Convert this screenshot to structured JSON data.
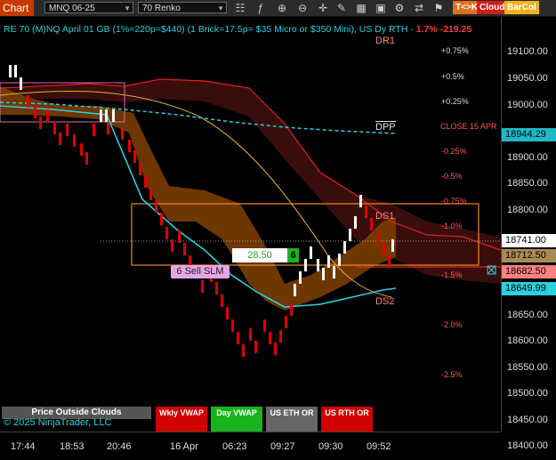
{
  "toolbar": {
    "tab_label": "Chart",
    "instrument": "MNQ 06-25",
    "bar_type": "70 Renko",
    "tkk_label": "T<>K",
    "cloud_label": "Cloud",
    "barcol_label": "BarCol"
  },
  "title": {
    "text": "RE 70 (M)NQ April 01 GB (1%=220p=$440) (1 Brick=17.5p= $35 Micro or $350 Mini), US Dy RTH  -",
    "change": "1.7%  -219.25"
  },
  "levels": {
    "dr1": "DR1",
    "dpp": "DPP",
    "ds1": "DS1",
    "ds2": "DS2",
    "close_label": "CLOSE 15 APR"
  },
  "pct_labels": [
    "+0.75%",
    "+0.5%",
    "+0.25%",
    "-0.25%",
    "-0.5%",
    "-0.75%",
    "-1.0%",
    "-1.5%",
    "-2.0%",
    "-2.5%"
  ],
  "y_ticks": [
    "19100.00",
    "19050.00",
    "19000.00",
    "18900.00",
    "18850.00",
    "18800.00",
    "18650.00",
    "18600.00",
    "18550.00",
    "18500.00",
    "18450.00",
    "18400.00"
  ],
  "price_labels": {
    "dpp": "18944.29",
    "last": "18741.00",
    "ds1": "18712.50",
    "ds2": "18682.50",
    "vwap": "18649.99"
  },
  "x_ticks": [
    "17:44",
    "18:53",
    "20:46",
    "16 Apr",
    "06:23",
    "09:27",
    "09:30",
    "09:52"
  ],
  "trade": {
    "ticks": "28.50",
    "count": "6",
    "order": "6 Sell SLM"
  },
  "panels": {
    "price_outside": "Price Outside Clouds",
    "wkly_vwap": "Wkly VWAP",
    "day_vwap": "Day VWAP",
    "us_eth": "US ETH OR",
    "us_rth": "US RTH OR"
  },
  "copyright": "© 2025 NinjaTrader, LLC",
  "colors": {
    "accent": "#c43a00",
    "up_brick": "#ffffff",
    "down_brick": "#e00000",
    "cloud": "#7a3d00",
    "vwap": "#2ad0e0"
  }
}
